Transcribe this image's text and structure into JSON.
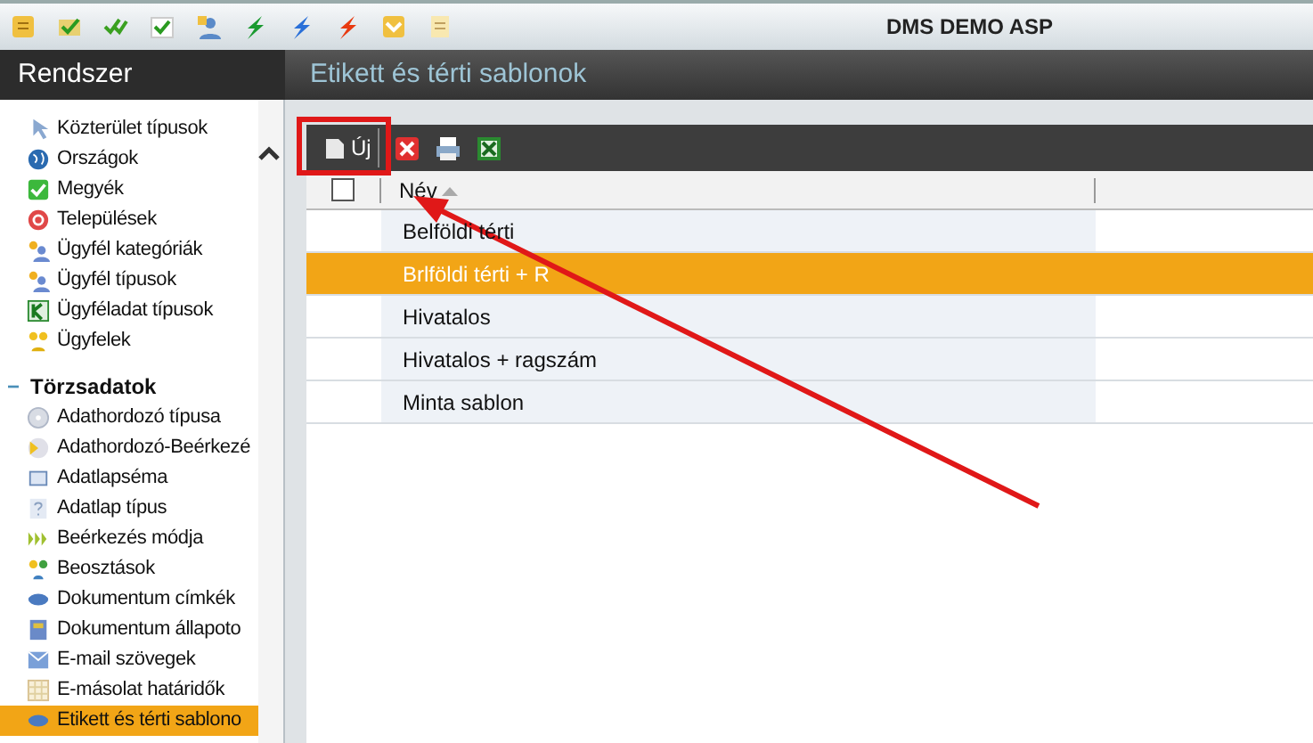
{
  "window": {
    "title": "DMS DEMO ASP"
  },
  "header": {
    "left_title": "Rendszer",
    "page_title": "Etikett és térti sablonok"
  },
  "sidebar": {
    "items": [
      {
        "label": "Közterület típusok",
        "selected": false
      },
      {
        "label": "Országok",
        "selected": false
      },
      {
        "label": "Megyék",
        "selected": false
      },
      {
        "label": "Települések",
        "selected": false
      },
      {
        "label": "Ügyfél kategóriák",
        "selected": false
      },
      {
        "label": "Ügyfél típusok",
        "selected": false
      },
      {
        "label": "Ügyféladat típusok",
        "selected": false
      },
      {
        "label": "Ügyfelek",
        "selected": false
      }
    ],
    "sections": [
      {
        "toggle": "−",
        "label": "Törzsadatok",
        "expanded": true,
        "items": [
          {
            "label": "Adathordozó típusa",
            "selected": false
          },
          {
            "label": "Adathordozó-Beérkezé",
            "selected": false
          },
          {
            "label": "Adatlapséma",
            "selected": false
          },
          {
            "label": "Adatlap típus",
            "selected": false
          },
          {
            "label": "Beérkezés módja",
            "selected": false
          },
          {
            "label": "Beosztások",
            "selected": false
          },
          {
            "label": "Dokumentum címkék",
            "selected": false
          },
          {
            "label": "Dokumentum állapoto",
            "selected": false
          },
          {
            "label": "E-mail szövegek",
            "selected": false
          },
          {
            "label": "E-másolat határidők",
            "selected": false
          },
          {
            "label": "Etikett és térti sablono",
            "selected": true
          }
        ]
      }
    ]
  },
  "toolbar": {
    "new_button": "Új"
  },
  "table": {
    "header_checked": false,
    "columns": [
      "Név"
    ],
    "rows": [
      {
        "name": "Belföldi térti",
        "selected": false
      },
      {
        "name": "Brlföldi térti + R",
        "selected": true
      },
      {
        "name": "Hivatalos",
        "selected": false
      },
      {
        "name": "Hivatalos + ragszám",
        "selected": false
      },
      {
        "name": "Minta sablon",
        "selected": false
      }
    ]
  }
}
